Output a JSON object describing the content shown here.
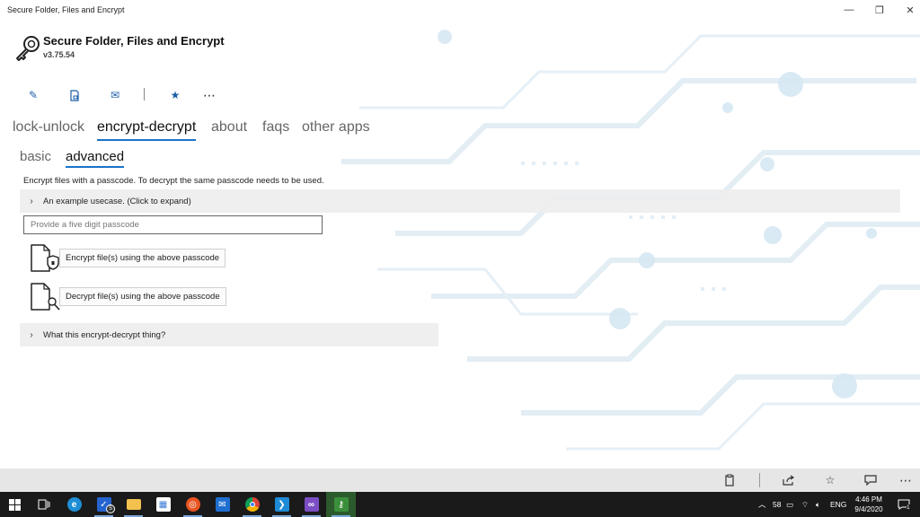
{
  "window": {
    "title": "Secure Folder, Files and Encrypt",
    "controls": [
      "minimize-icon",
      "restore-icon",
      "close-icon"
    ]
  },
  "app": {
    "name": "Secure Folder, Files and Encrypt",
    "version": "v3.75.54",
    "logo": "key-icon"
  },
  "toolbar": {
    "items": [
      {
        "name": "edit-icon",
        "glyph": "✎"
      },
      {
        "name": "document-lock-icon",
        "glyph": "▯"
      },
      {
        "name": "mail-icon",
        "glyph": "✉"
      },
      {
        "name": "star-icon",
        "glyph": "★"
      },
      {
        "name": "more-icon",
        "glyph": "⋯"
      }
    ]
  },
  "main_tabs": [
    {
      "label": "lock-unlock",
      "active": false
    },
    {
      "label": "encrypt-decrypt",
      "active": true
    },
    {
      "label": "about",
      "active": false
    },
    {
      "label": "faqs",
      "active": false
    },
    {
      "label": "other apps",
      "active": false
    }
  ],
  "sub_tabs": [
    {
      "label": "basic",
      "active": false
    },
    {
      "label": "advanced",
      "active": true
    }
  ],
  "content": {
    "description": "Encrypt files with a passcode. To decrypt the same passcode needs to be used.",
    "example_expander": "An example usecase. (Click to expand)",
    "passcode_placeholder": "Provide a five digit passcode",
    "passcode_value": "",
    "encrypt_button": "Encrypt file(s) using the above passcode",
    "decrypt_button": "Decrypt file(s) using the above passcode",
    "what_expander": "What this encrypt-decrypt thing?"
  },
  "bottom_bar": {
    "items": [
      "clipboard-icon",
      "share-icon",
      "star-outline-icon",
      "feedback-icon",
      "more-icon"
    ]
  },
  "taskbar": {
    "apps": [
      {
        "name": "start-icon"
      },
      {
        "name": "task-view-icon"
      },
      {
        "name": "edge-icon",
        "color": "#1e8fd6"
      },
      {
        "name": "todo-icon",
        "color": "#2564cf",
        "badge": "5"
      },
      {
        "name": "file-explorer-icon",
        "color": "#f2c14e"
      },
      {
        "name": "store-icon",
        "color": "#3a7bd5"
      },
      {
        "name": "ubuntu-icon",
        "color": "#e95420"
      },
      {
        "name": "mail-icon",
        "color": "#1f6fd1"
      },
      {
        "name": "chrome-icon",
        "color": "#e8b400"
      },
      {
        "name": "vscode-icon",
        "color": "#1f8ad6"
      },
      {
        "name": "visual-studio-icon",
        "color": "#7b4ec4"
      },
      {
        "name": "secure-folder-icon",
        "color": "#3b8f3b",
        "active": true
      }
    ],
    "tray": {
      "wifi_count": "58",
      "language": "ENG",
      "time": "4:46 PM",
      "date": "9/4/2020",
      "notifications": "1"
    }
  },
  "colors": {
    "accent": "#1a73c8",
    "toolbar_icon": "#1a5fa8",
    "taskbar": "#1a1a1a"
  }
}
